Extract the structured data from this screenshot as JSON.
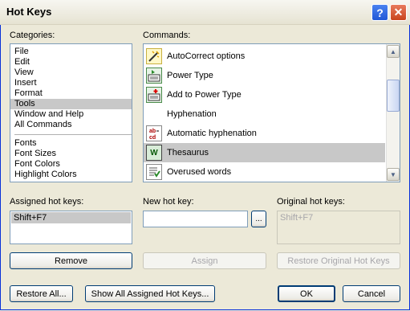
{
  "window": {
    "title": "Hot Keys",
    "help_label": "?",
    "close_label": "✕"
  },
  "categories": {
    "label": "Categories:",
    "items": [
      "File",
      "Edit",
      "View",
      "Insert",
      "Format",
      "Tools",
      "Window and Help",
      "All Commands"
    ],
    "items2": [
      "Fonts",
      "Font Sizes",
      "Font Colors",
      "Highlight Colors"
    ],
    "selected": "Tools"
  },
  "commands": {
    "label": "Commands:",
    "items": [
      {
        "label": "AutoCorrect options",
        "icon": "autocorrect-icon"
      },
      {
        "label": "Power Type",
        "icon": "power-type-icon"
      },
      {
        "label": "Add to Power Type",
        "icon": "add-power-type-icon"
      },
      {
        "label": "Hyphenation",
        "icon": ""
      },
      {
        "label": "Automatic hyphenation",
        "icon": "hyphenation-icon"
      },
      {
        "label": "Thesaurus",
        "icon": "thesaurus-icon"
      },
      {
        "label": "Overused words",
        "icon": "overused-words-icon"
      }
    ],
    "selected": "Thesaurus"
  },
  "assigned": {
    "label": "Assigned hot keys:",
    "items": [
      "Shift+F7"
    ]
  },
  "new_hotkey": {
    "label": "New hot key:",
    "value": "",
    "browse_label": "..."
  },
  "original": {
    "label": "Original hot keys:",
    "value": "Shift+F7"
  },
  "buttons": {
    "remove": "Remove",
    "assign": "Assign",
    "restore_original": "Restore Original Hot Keys",
    "restore_all": "Restore All...",
    "show_all": "Show All Assigned Hot Keys...",
    "ok": "OK",
    "cancel": "Cancel"
  }
}
